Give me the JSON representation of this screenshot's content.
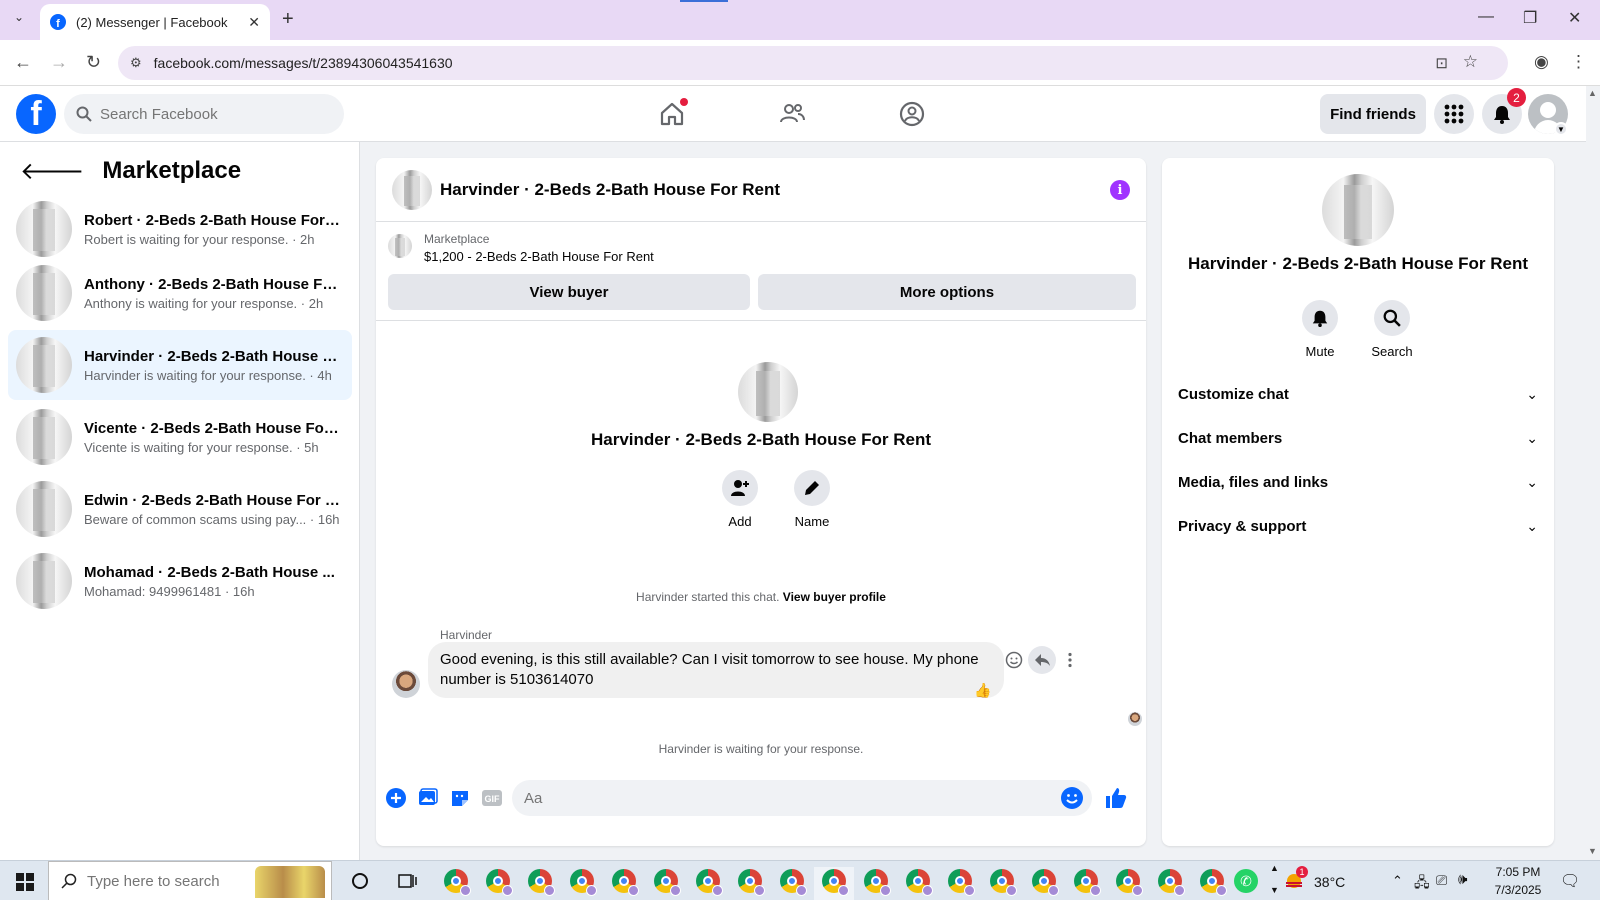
{
  "browser": {
    "tab_title": "(2) Messenger | Facebook",
    "url": "facebook.com/messages/t/23894306043541630"
  },
  "fb_nav": {
    "search_placeholder": "Search Facebook",
    "find_friends": "Find friends",
    "notifications_count": "2"
  },
  "sidebar": {
    "title": "Marketplace",
    "conversations": [
      {
        "name": "Robert · 2-Beds 2-Bath House For ...",
        "subtitle": "Robert is waiting for your response. · 2h"
      },
      {
        "name": "Anthony · 2-Beds 2-Bath House Fo...",
        "subtitle": "Anthony is waiting for your response. · 2h"
      },
      {
        "name": "Harvinder · 2-Beds 2-Bath House F...",
        "subtitle": "Harvinder is waiting for your response. · 4h"
      },
      {
        "name": "Vicente · 2-Beds 2-Bath House For...",
        "subtitle": "Vicente is waiting for your response. · 5h"
      },
      {
        "name": "Edwin · 2-Beds 2-Bath House For R...",
        "subtitle": "Beware of common scams using pay... · 16h"
      },
      {
        "name": "Mohamad · 2-Beds 2-Bath House ...",
        "subtitle": "Mohamad: 9499961481 · 16h"
      }
    ]
  },
  "chat": {
    "title": "Harvinder · 2-Beds 2-Bath House For Rent",
    "listing_source": "Marketplace",
    "listing_title": "$1,200 - 2-Beds 2-Bath House For Rent",
    "view_buyer": "View buyer",
    "more_options": "More options",
    "profile_name": "Harvinder · 2-Beds 2-Bath House For Rent",
    "add_label": "Add",
    "name_label": "Name",
    "started_text": "Harvinder started this chat.",
    "view_buyer_profile": "View buyer profile",
    "sender": "Harvinder",
    "message": "Good evening, is this still available? Can I visit tomorrow to see house. My phone number is 5103614070",
    "waiting": "Harvinder is waiting for your response.",
    "composer_placeholder": "Aa"
  },
  "right_panel": {
    "name": "Harvinder · 2-Beds 2-Bath House For Rent",
    "mute": "Mute",
    "search": "Search",
    "sections": [
      "Customize chat",
      "Chat members",
      "Media, files and links",
      "Privacy & support"
    ]
  },
  "taskbar": {
    "search_placeholder": "Type here to search",
    "temperature": "38°C",
    "weather_badge": "1",
    "time": "7:05 PM",
    "date": "7/3/2025"
  },
  "colors": {
    "fb_blue": "#0866ff",
    "active_conv": "#ebf5ff",
    "info_purple": "#a033ff",
    "badge_red": "#e41e3f"
  }
}
